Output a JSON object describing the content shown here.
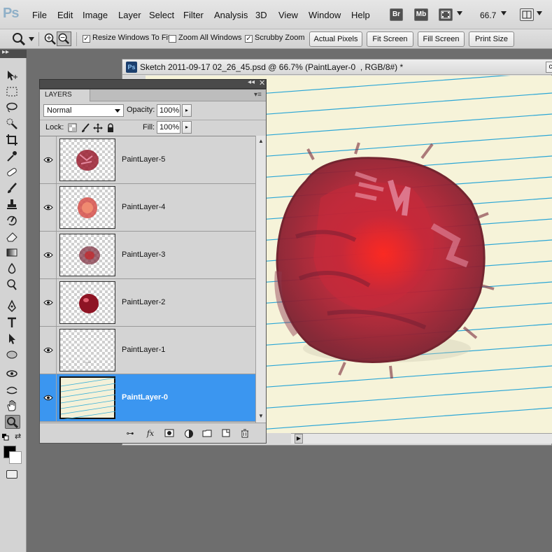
{
  "app": {
    "logo": "Ps"
  },
  "menu": [
    "File",
    "Edit",
    "Image",
    "Layer",
    "Select",
    "Filter",
    "Analysis",
    "3D",
    "View",
    "Window",
    "Help"
  ],
  "topbar": {
    "bridge": "Br",
    "minibridge": "Mb",
    "zoom": "66.7"
  },
  "options": {
    "resize_windows": "Resize Windows To Fit",
    "zoom_all": "Zoom All Windows",
    "scrubby_zoom": "Scrubby Zoom",
    "actual_pixels": "Actual Pixels",
    "fit_screen": "Fit Screen",
    "fill_screen": "Fill Screen",
    "print_size": "Print Size"
  },
  "document": {
    "icon": "Ps",
    "title": "Sketch 2011-09-17 02_26_45.psd @ 66.7% (PaintLayer-0  , RGB/8#) *"
  },
  "layers_panel": {
    "tab": "LAYERS",
    "blend_mode": "Normal",
    "opacity_label": "Opacity:",
    "opacity": "100%",
    "lock_label": "Lock:",
    "fill_label": "Fill:",
    "fill": "100%",
    "layers": [
      {
        "name": "PaintLayer-5"
      },
      {
        "name": "PaintLayer-4"
      },
      {
        "name": "PaintLayer-3"
      },
      {
        "name": "PaintLayer-2"
      },
      {
        "name": "PaintLayer-1"
      },
      {
        "name": "PaintLayer-0"
      }
    ],
    "footer_icons": [
      "link-icon",
      "fx-icon",
      "layer-mask-icon",
      "adjustment-layer-icon",
      "group-icon",
      "new-layer-icon",
      "trash-icon"
    ]
  },
  "colors": {
    "foreground": "#000000",
    "background": "#ffffff",
    "selection": "#3b96f0",
    "paper": "#f4f1d9",
    "ruled_line": "#2aa6d6"
  }
}
